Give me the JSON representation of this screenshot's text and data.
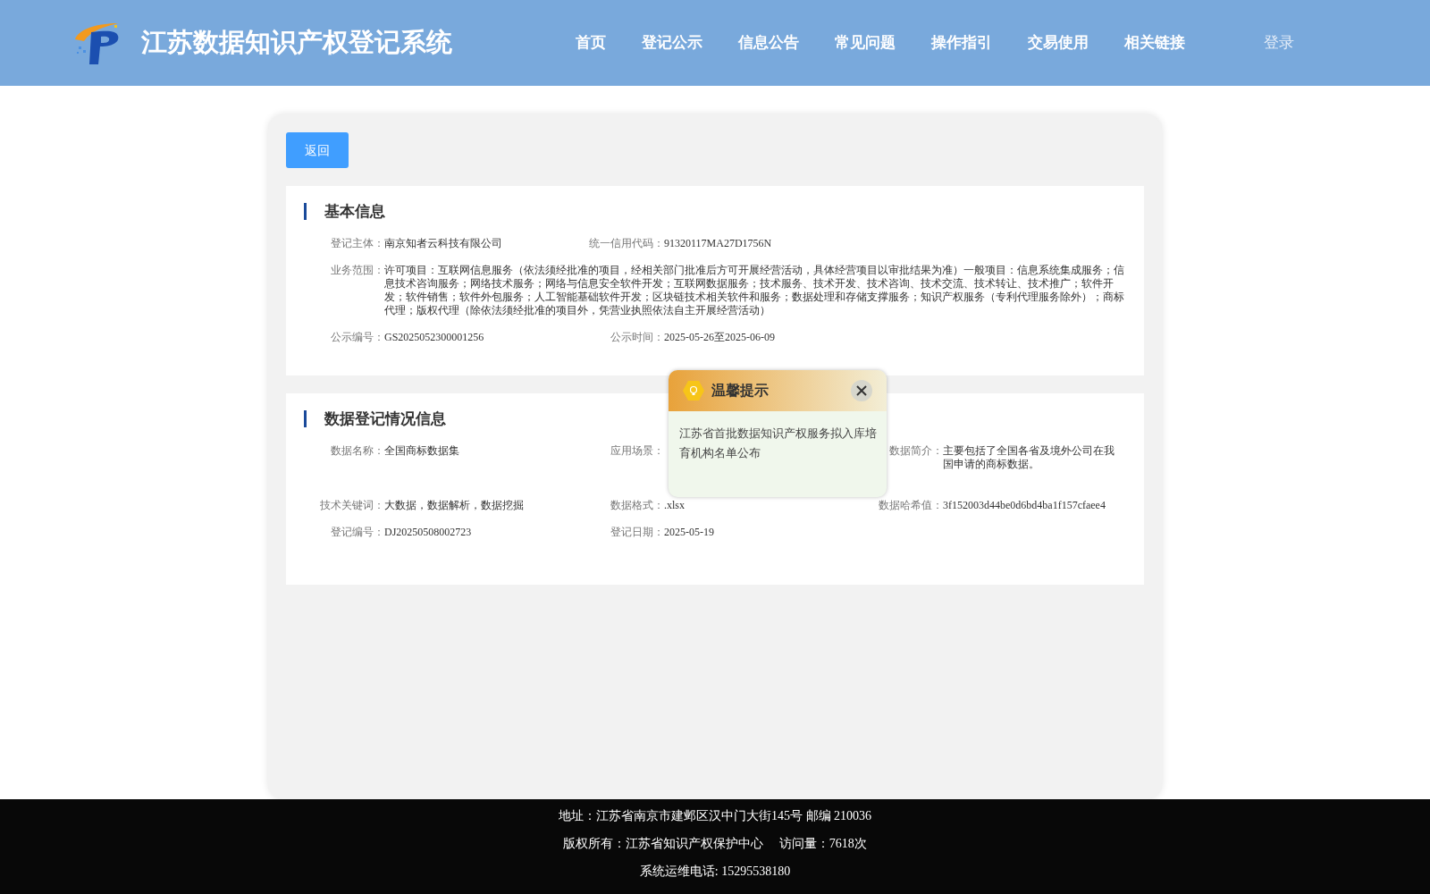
{
  "header": {
    "title": "江苏数据知识产权登记系统",
    "nav": [
      "首页",
      "登记公示",
      "信息公告",
      "常见问题",
      "操作指引",
      "交易使用",
      "相关链接"
    ],
    "login": "登录"
  },
  "back_button": "返回",
  "sections": [
    {
      "title": "基本信息",
      "rows": [
        [
          {
            "label": "登记主体：",
            "value": "南京知者云科技有限公司"
          },
          {
            "label": "统一信用代码：",
            "value": "91320117MA27D1756N"
          }
        ],
        [
          {
            "label": "业务范围：",
            "value": "许可项目：互联网信息服务（依法须经批准的项目，经相关部门批准后方可开展经营活动，具体经营项目以审批结果为准）一般项目：信息系统集成服务；信息技术咨询服务；网络技术服务；网络与信息安全软件开发；互联网数据服务；技术服务、技术开发、技术咨询、技术交流、技术转让、技术推广；软件开发；软件销售；软件外包服务；人工智能基础软件开发；区块链技术相关软件和服务；数据处理和存储支撑服务；知识产权服务（专利代理服务除外）；商标代理；版权代理（除依法须经批准的项目外，凭营业执照依法自主开展经营活动）"
          }
        ],
        [
          {
            "label": "公示编号：",
            "value": "GS2025052300001256"
          },
          {
            "label": "公示时间：",
            "value": "2025-05-26至2025-06-09"
          }
        ]
      ]
    },
    {
      "title": "数据登记情况信息",
      "rows": [
        [
          {
            "label": "数据名称：",
            "value": "全国商标数据集"
          },
          {
            "label": "应用场景："
          },
          {
            "label": "数据简介：",
            "value": "主要包括了全国各省及境外公司在我国申请的商标数据。"
          }
        ],
        [
          {
            "label": "技术关键词：",
            "value": "大数据，数据解析，数据挖掘"
          },
          {
            "label": "数据格式：",
            "value": ".xlsx"
          },
          {
            "label": "数据哈希值：",
            "value": "3f152003d44be0d6bd4ba1f157cfaee4"
          }
        ],
        [
          {
            "label": "登记编号：",
            "value": "DJ20250508002723"
          },
          {
            "label": "登记日期：",
            "value": "2025-05-19"
          }
        ]
      ]
    }
  ],
  "popup": {
    "title": "温馨提示",
    "message": "江苏省首批数据知识产权服务拟入库培育机构名单公布"
  },
  "footer": [
    "地址：江苏省南京市建邺区汉中门大街145号 邮编 210036",
    "版权所有：江苏省知识产权保护中心　 访问量：7618次",
    "系统运维电话: 15295538180"
  ]
}
